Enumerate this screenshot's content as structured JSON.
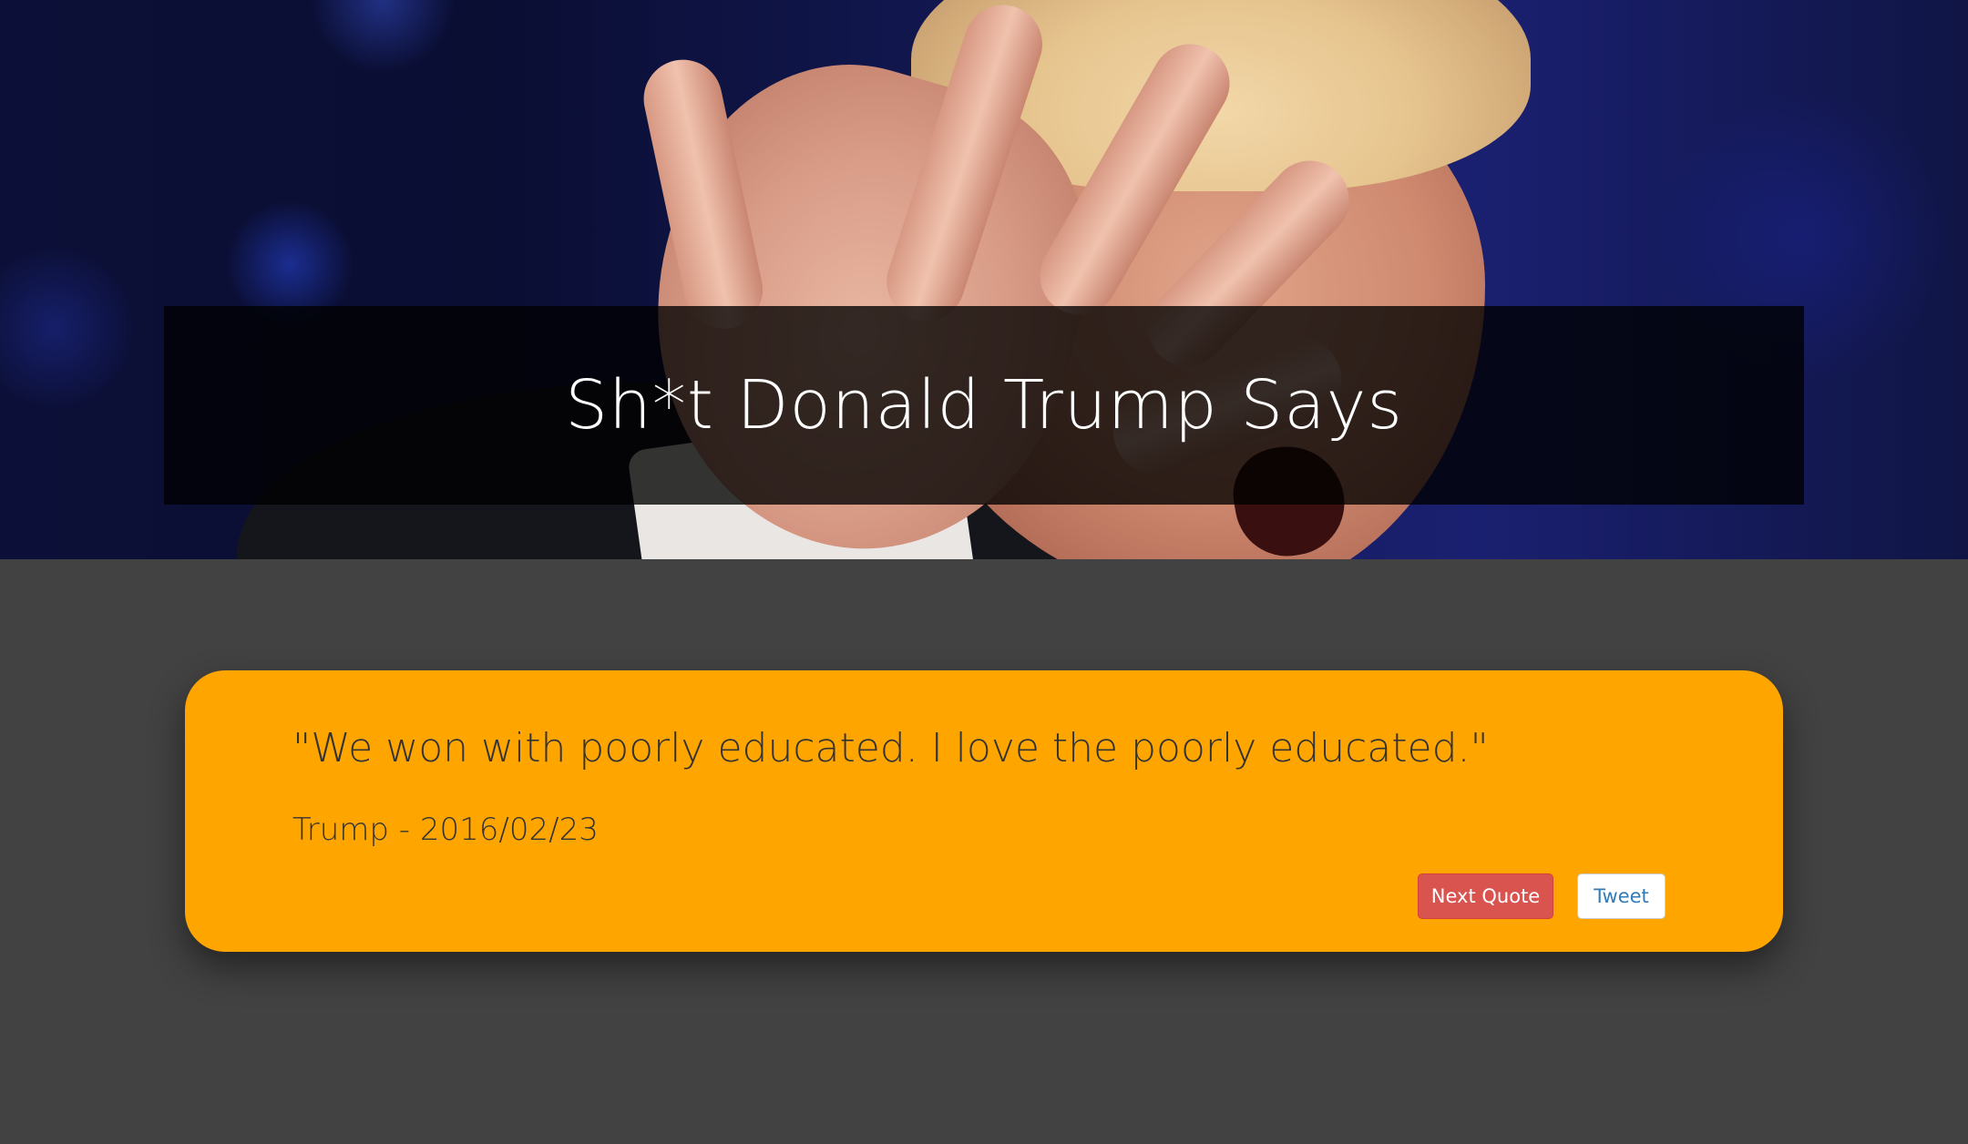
{
  "header": {
    "title": "Sh*t Donald Trump Says"
  },
  "quote": {
    "text": "\"We won with poorly educated. I love the poorly educated.\"",
    "author": "Trump - 2016/02/23"
  },
  "actions": {
    "next_label": "Next Quote",
    "tweet_label": "Tweet"
  },
  "colors": {
    "page_background": "#424242",
    "card_background": "#ffa500",
    "next_button": "#d9534f",
    "tweet_text": "#337ab7"
  }
}
